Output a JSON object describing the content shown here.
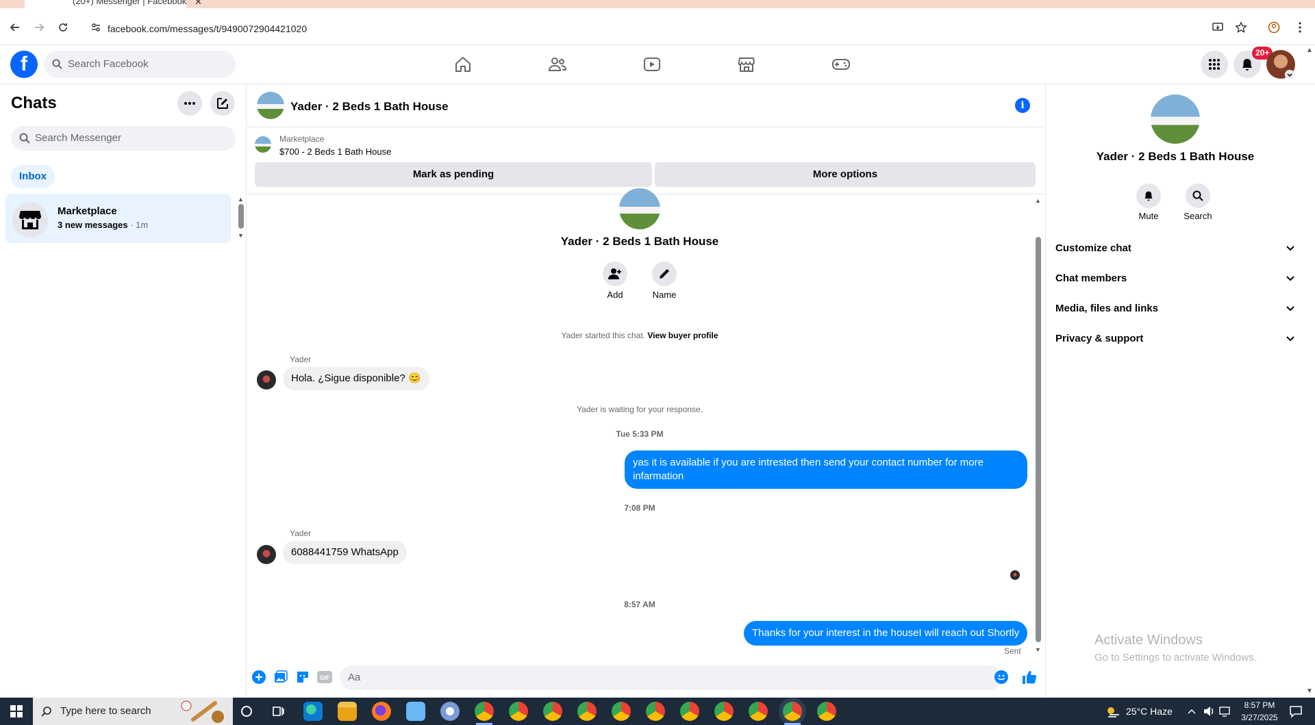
{
  "browser": {
    "tab_title": "(20+) Messenger | Facebook",
    "tab_close": "✕",
    "new_tab": "+",
    "url": "facebook.com/messages/t/9490072904421020"
  },
  "fb": {
    "logo": "f",
    "search_placeholder": "Search Facebook",
    "notification_badge": "20+"
  },
  "chats": {
    "title": "Chats",
    "search_placeholder": "Search Messenger",
    "filter": "Inbox",
    "items": [
      {
        "name": "Marketplace",
        "preview": "3 new messages",
        "time": " · 1m"
      }
    ]
  },
  "conversation": {
    "title": "Yader · 2 Beds 1 Bath House",
    "marketplace_label": "Marketplace",
    "listing": "$700 - 2 Beds 1 Bath House",
    "mark_pending": "Mark as pending",
    "more_options": "More options",
    "intro_name": "Yader · 2 Beds 1 Bath House",
    "add_label": "Add",
    "name_label": "Name",
    "started_text": "Yader started this chat.",
    "view_buyer_profile": "View buyer profile",
    "messages": [
      {
        "sender": "Yader",
        "text": "Hola. ¿Sigue disponible? 😊"
      },
      {
        "note": "Yader is waiting for your response."
      },
      {
        "timestamp": "Tue 5:33 PM"
      },
      {
        "text_out": "yas it is available if you are intrested then send your contact number for more infarmation"
      },
      {
        "timestamp": "7:08 PM"
      },
      {
        "sender": "Yader",
        "text": "6088441759 WhatsApp"
      },
      {
        "timestamp": "8:57 AM"
      },
      {
        "text_out": "Thanks for your interest in the houseI will reach out Shortly"
      }
    ],
    "sent_label": "Sent",
    "composer_placeholder": "Aa"
  },
  "right_panel": {
    "name": "Yader · 2 Beds 1 Bath House",
    "mute": "Mute",
    "search": "Search",
    "sections": [
      "Customize chat",
      "Chat members",
      "Media, files and links",
      "Privacy & support"
    ]
  },
  "watermark": {
    "line1": "Activate Windows",
    "line2": "Go to Settings to activate Windows."
  },
  "taskbar": {
    "search_placeholder": "Type here to search",
    "weather": "25°C  Haze",
    "time": "8:57 PM",
    "date": "3/27/2025"
  },
  "colors": {
    "brand_blue": "#0866ff",
    "bubble_out": "#0084ff",
    "selected_bg": "#e7f3ff",
    "badge_red": "#e41e3f"
  }
}
